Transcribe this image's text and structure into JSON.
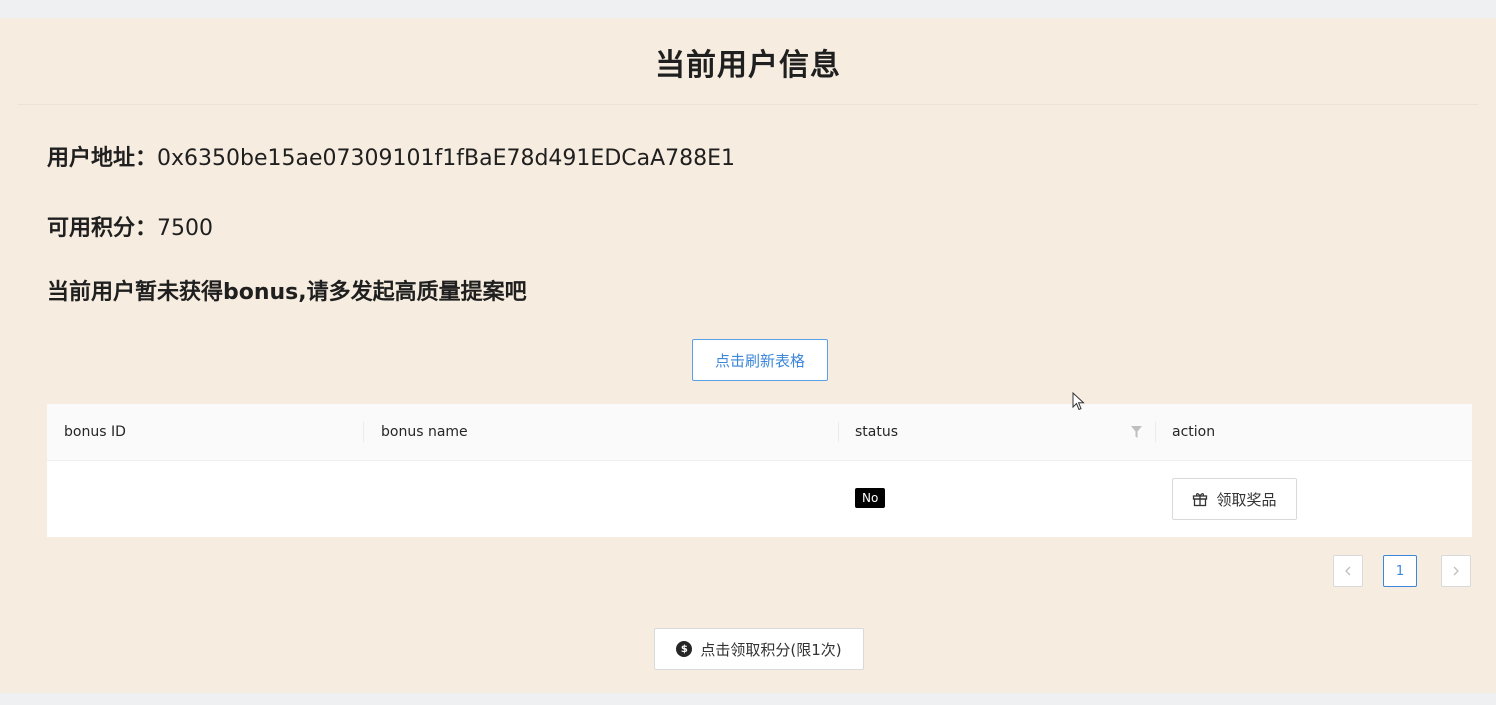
{
  "page": {
    "title": "当前用户信息"
  },
  "user": {
    "address_label": "用户地址：",
    "address_value": "0x6350be15ae07309101f1fBaE78d491EDCaA788E1",
    "points_label": "可用积分：",
    "points_value": "7500",
    "notice": "当前用户暂未获得bonus,请多发起高质量提案吧"
  },
  "buttons": {
    "refresh_label": "点击刷新表格",
    "claim_points_label": "点击领取积分(限1次)",
    "claim_points_icon": "dollar-coin-icon"
  },
  "table": {
    "columns": [
      "bonus ID",
      "bonus name",
      "status",
      "action"
    ],
    "rows": [
      {
        "bonus_id": "",
        "bonus_name": "",
        "status": "No",
        "action_label": "领取奖品",
        "action_icon": "gift-icon"
      }
    ]
  },
  "pagination": {
    "current_page": "1",
    "prev_icon": "chevron-left-icon",
    "next_icon": "chevron-right-icon"
  }
}
